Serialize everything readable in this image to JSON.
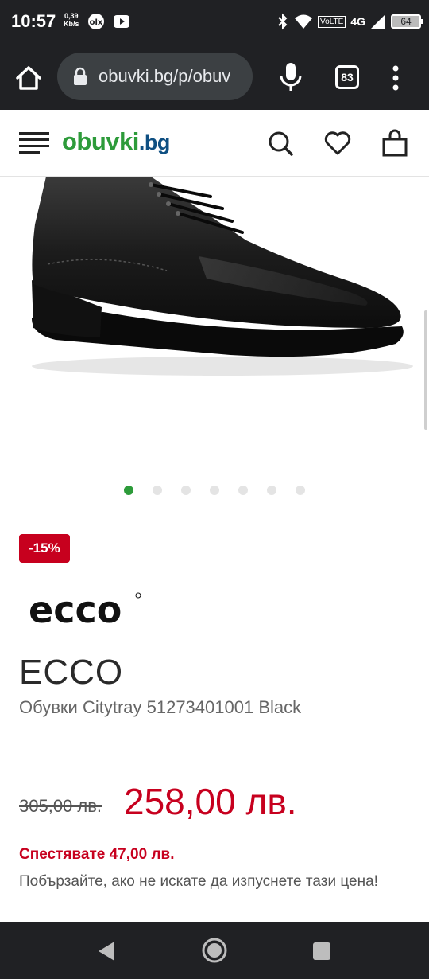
{
  "status_bar": {
    "time": "10:57",
    "speed_value": "0,39",
    "speed_unit": "Kb/s",
    "volte": "VoLTE",
    "network": "4G",
    "battery": "64"
  },
  "browser": {
    "url": "obuvki.bg/p/obuv",
    "tab_count": "83"
  },
  "site": {
    "logo_brand": "obuvki",
    "logo_tld": ".bg",
    "accent_color": "#2d9b3a"
  },
  "gallery": {
    "dot_count": 7,
    "active_index": 0
  },
  "product": {
    "discount": "-15%",
    "brand_logo_text": "ecco",
    "brand": "ECCO",
    "title": "Обувки Citytray 51273401001 Black",
    "old_price": "305,00 лв.",
    "new_price": "258,00 лв.",
    "savings": "Спестявате 47,00 лв.",
    "hurry_text": "Побързайте, ако не искате да изпуснете тази цена!",
    "price_color": "#c7001e"
  }
}
